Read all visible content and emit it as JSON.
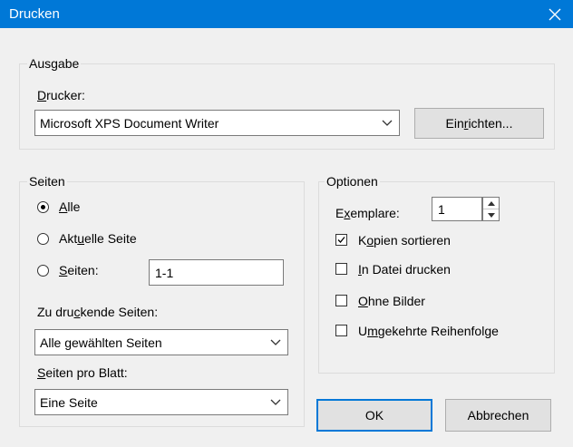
{
  "window": {
    "title": "Drucken"
  },
  "ausgabe": {
    "legend": "Ausgabe",
    "printer_label_pre": "",
    "printer_label_u": "D",
    "printer_label_post": "rucker:",
    "printer_value": "Microsoft XPS Document Writer",
    "setup_pre": "Ein",
    "setup_u": "r",
    "setup_post": "ichten..."
  },
  "seiten": {
    "legend": "Seiten",
    "all_u": "A",
    "all_post": "lle",
    "current_pre": "Akt",
    "current_u": "u",
    "current_post": "elle Seite",
    "pages_u": "S",
    "pages_post": "eiten:",
    "pages_value": "1-1",
    "print_pages_pre": "Zu dru",
    "print_pages_u": "c",
    "print_pages_post": "kende Seiten:",
    "print_pages_value": "Alle gewählten Seiten",
    "per_sheet_pre": "",
    "per_sheet_u": "S",
    "per_sheet_post": "eiten pro Blatt:",
    "per_sheet_value": "Eine Seite",
    "selected": "all"
  },
  "optionen": {
    "legend": "Optionen",
    "copies_pre": "E",
    "copies_u": "x",
    "copies_post": "emplare:",
    "copies_value": "1",
    "collate_pre": "K",
    "collate_u": "o",
    "collate_post": "pien sortieren",
    "collate_checked": true,
    "file_u": "I",
    "file_post": "n Datei drucken",
    "noimg_u": "O",
    "noimg_post": "hne Bilder",
    "reverse_pre": "U",
    "reverse_u": "m",
    "reverse_post": "gekehrte Reihenfolge"
  },
  "buttons": {
    "ok": "OK",
    "cancel": "Abbrechen"
  }
}
